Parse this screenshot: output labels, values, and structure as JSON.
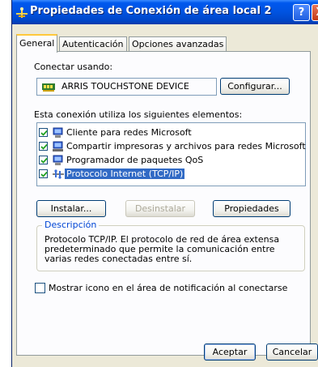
{
  "window": {
    "title": "Propiedades de Conexión de área local 2",
    "help_label": "?",
    "close_label": "X"
  },
  "tabs": [
    {
      "label": "General",
      "active": true
    },
    {
      "label": "Autenticación",
      "active": false
    },
    {
      "label": "Opciones avanzadas",
      "active": false
    }
  ],
  "general": {
    "connect_using_label": "Conectar usando:",
    "device_name": "ARRIS TOUCHSTONE DEVICE",
    "configure_button": "Configurar...",
    "components_label": "Esta conexión utiliza los siguientes elementos:",
    "components": [
      {
        "label": "Cliente para redes Microsoft",
        "checked": true,
        "icon": "network-client-icon"
      },
      {
        "label": "Compartir impresoras y archivos para redes Microsoft",
        "checked": true,
        "icon": "file-printer-sharing-icon"
      },
      {
        "label": "Programador de paquetes QoS",
        "checked": true,
        "icon": "qos-scheduler-icon"
      },
      {
        "label": "Protocolo Internet (TCP/IP)",
        "checked": true,
        "icon": "protocol-icon",
        "selected": true
      }
    ],
    "install_button": "Instalar...",
    "uninstall_button": "Desinstalar",
    "properties_button": "Propiedades",
    "description_title": "Descripción",
    "description_text": "Protocolo TCP/IP. El protocolo de red de área extensa predeterminado que permite la comunicación entre varias redes conectadas entre sí.",
    "notify_label": "Mostrar icono en el área de notificación al conectarse",
    "notify_checked": false
  },
  "footer": {
    "ok_button": "Aceptar",
    "cancel_button": "Cancelar"
  }
}
